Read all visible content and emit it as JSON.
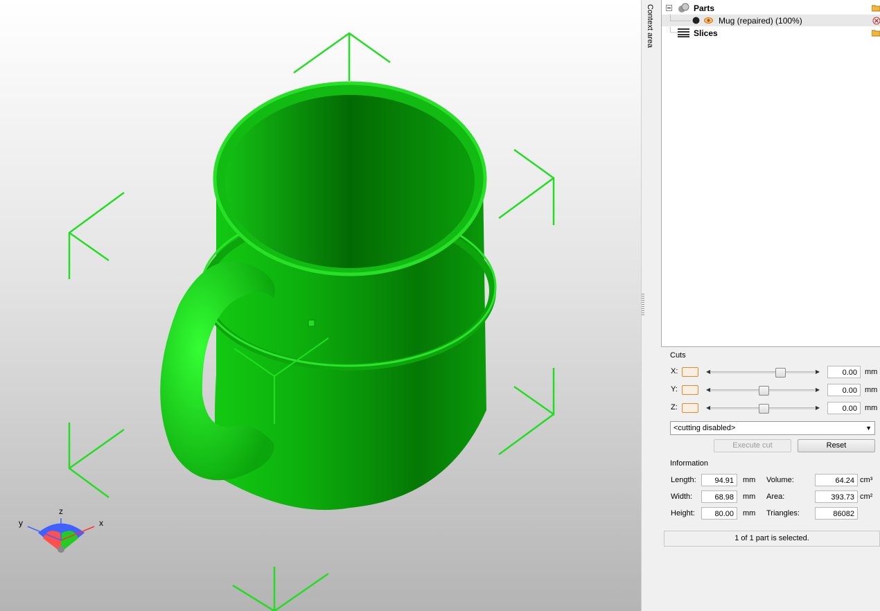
{
  "sidebar": {
    "context_label": "Context area"
  },
  "tree": {
    "parts_label": "Parts",
    "part_item": "Mug (repaired) (100%)",
    "slices_label": "Slices"
  },
  "cuts": {
    "title": "Cuts",
    "rows": [
      {
        "axis": "X:",
        "value": "0.00",
        "unit": "mm",
        "slider_pos": 0.68
      },
      {
        "axis": "Y:",
        "value": "0.00",
        "unit": "mm",
        "slider_pos": 0.5
      },
      {
        "axis": "Z:",
        "value": "0.00",
        "unit": "mm",
        "slider_pos": 0.5
      }
    ],
    "mode": "<cutting disabled>",
    "execute_label": "Execute cut",
    "reset_label": "Reset"
  },
  "info": {
    "title": "Information",
    "length_label": "Length:",
    "length": "94.91",
    "length_unit": "mm",
    "width_label": "Width:",
    "width": "68.98",
    "width_unit": "mm",
    "height_label": "Height:",
    "height": "80.00",
    "height_unit": "mm",
    "volume_label": "Volume:",
    "volume": "64.24",
    "volume_unit": "cm³",
    "area_label": "Area:",
    "area": "393.73",
    "area_unit": "cm²",
    "triangles_label": "Triangles:",
    "triangles": "86082"
  },
  "status": "1 of 1 part is selected.",
  "gizmo": {
    "x": "x",
    "y": "y",
    "z": "z"
  },
  "colors": {
    "model": "#19c519",
    "bbox": "#22dd22",
    "accent": "#e08a32"
  },
  "icons": [
    "expand-minus-icon",
    "parts-icon",
    "solid-dot-icon",
    "eye-icon",
    "folder-icon",
    "remove-icon",
    "slices-icon"
  ]
}
